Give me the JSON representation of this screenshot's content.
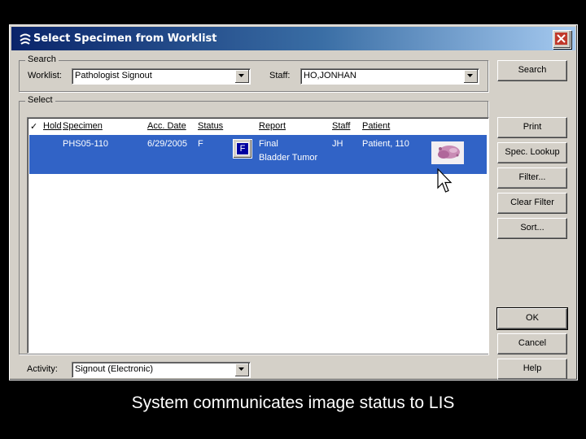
{
  "window": {
    "title": "Select Specimen from Worklist",
    "close_label": "✕"
  },
  "search_group": {
    "label": "Search",
    "worklist_label": "Worklist:",
    "worklist_value": "Pathologist Signout",
    "staff_label": "Staff:",
    "staff_value": "HO,JONHAN"
  },
  "select_group": {
    "label": "Select",
    "headers": {
      "check": "✓",
      "hold": "Hold",
      "specimen": "Specimen",
      "acc_date": "Acc. Date",
      "status": "Status",
      "report": "Report",
      "staff": "Staff",
      "patient": "Patient"
    },
    "rows": [
      {
        "specimen": "PHS05-110",
        "acc_date": "6/29/2005",
        "status": "F",
        "status_badge": "F",
        "report_line1": "Final",
        "report_line2": "Bladder Tumor",
        "staff": "JH",
        "patient": "Patient, 110",
        "thumbnail": "tissue-image-thumbnail"
      }
    ]
  },
  "activity": {
    "label": "Activity:",
    "value": "Signout (Electronic)"
  },
  "buttons": {
    "search": "Search",
    "print": "Print",
    "spec_lookup": "Spec. Lookup",
    "filter": "Filter...",
    "clear_filter": "Clear Filter",
    "sort": "Sort...",
    "ok": "OK",
    "cancel": "Cancel",
    "help": "Help"
  },
  "caption": "System communicates image status to LIS",
  "colors": {
    "title_bar": "#0a246a",
    "selection": "#3163c6",
    "dialog_face": "#d4d0c8",
    "background": "#000000"
  }
}
